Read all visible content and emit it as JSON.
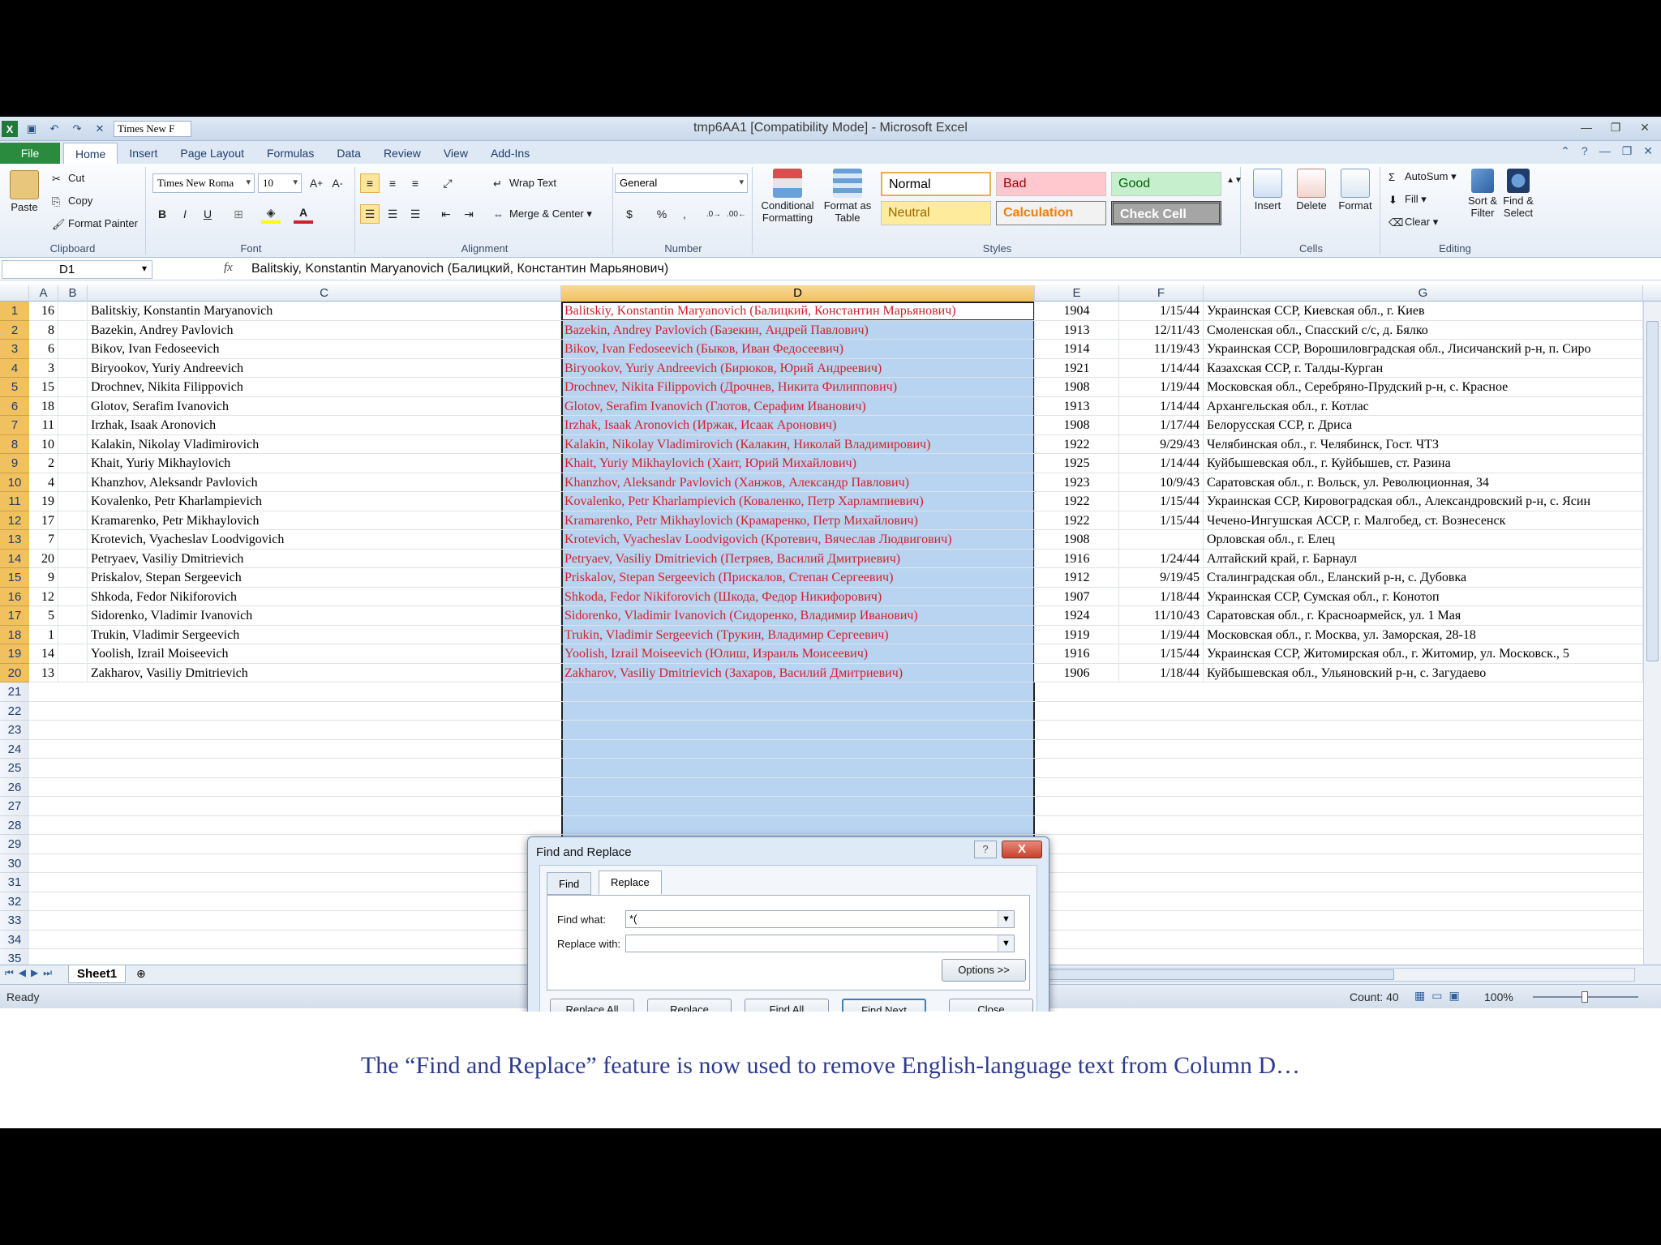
{
  "window": {
    "title": "tmp6AA1  [Compatibility Mode]  -  Microsoft Excel",
    "qat_font": "Times New F"
  },
  "ribbon_tabs": [
    "File",
    "Home",
    "Insert",
    "Page Layout",
    "Formulas",
    "Data",
    "Review",
    "View",
    "Add-Ins"
  ],
  "ribbon": {
    "clipboard": {
      "label": "Clipboard",
      "paste": "Paste",
      "cut": "Cut",
      "copy": "Copy",
      "format_painter": "Format Painter"
    },
    "font": {
      "label": "Font",
      "name": "Times New Roma",
      "size": "10"
    },
    "alignment": {
      "label": "Alignment",
      "wrap": "Wrap Text",
      "merge": "Merge & Center"
    },
    "number": {
      "label": "Number",
      "format": "General"
    },
    "styles": {
      "label": "Styles",
      "conditional": "Conditional Formatting",
      "format_table": "Format as Table",
      "normal": "Normal",
      "bad": "Bad",
      "good": "Good",
      "neutral": "Neutral",
      "calculation": "Calculation",
      "check_cell": "Check Cell"
    },
    "cells": {
      "label": "Cells",
      "insert": "Insert",
      "delete": "Delete",
      "format": "Format"
    },
    "editing": {
      "label": "Editing",
      "autosum": "AutoSum",
      "fill": "Fill",
      "clear": "Clear",
      "sort": "Sort & Filter",
      "find": "Find & Select"
    }
  },
  "formula_bar": {
    "name_box": "D1",
    "fx": "fx",
    "content": "Balitskiy, Konstantin Maryanovich (Балицкий, Константин Марьянович)"
  },
  "columns": [
    "A",
    "B",
    "C",
    "D",
    "E",
    "F",
    "G"
  ],
  "rows": [
    {
      "n": "1",
      "a": "16",
      "c": "Balitskiy, Konstantin Maryanovich",
      "d": "Balitskiy, Konstantin Maryanovich (Балицкий, Константин Марьянович)",
      "e": "1904",
      "f": "1/15/44",
      "g": "Украинская ССР, Киевская обл., г. Киев"
    },
    {
      "n": "2",
      "a": "8",
      "c": "Bazekin, Andrey Pavlovich",
      "d": "Bazekin, Andrey Pavlovich (Базекин, Андрей Павлович)",
      "e": "1913",
      "f": "12/11/43",
      "g": "Смоленская обл., Спасский с/с, д. Бялко"
    },
    {
      "n": "3",
      "a": "6",
      "c": "Bikov, Ivan Fedoseevich",
      "d": "Bikov, Ivan Fedoseevich (Быков, Иван Федосеевич)",
      "e": "1914",
      "f": "11/19/43",
      "g": "Украинская ССР, Ворошиловградская обл., Лисичанский р-н, п. Сиро"
    },
    {
      "n": "4",
      "a": "3",
      "c": "Biryookov, Yuriy Andreevich",
      "d": "Biryookov, Yuriy Andreevich (Бирюков, Юрий Андреевич)",
      "e": "1921",
      "f": "1/14/44",
      "g": "Казахская ССР, г. Талды-Курган"
    },
    {
      "n": "5",
      "a": "15",
      "c": "Drochnev, Nikita Filippovich",
      "d": "Drochnev, Nikita Filippovich (Дрочнев, Никита Филиппович)",
      "e": "1908",
      "f": "1/19/44",
      "g": "Московская обл., Серебряно-Прудский р-н, с. Красное"
    },
    {
      "n": "6",
      "a": "18",
      "c": "Glotov, Serafim Ivanovich",
      "d": "Glotov, Serafim Ivanovich (Глотов, Серафим Иванович)",
      "e": "1913",
      "f": "1/14/44",
      "g": "Архангельская обл., г. Котлас"
    },
    {
      "n": "7",
      "a": "11",
      "c": "Irzhak, Isaak Aronovich",
      "d": "Irzhak, Isaak Aronovich (Иржак, Исаак Аронович)",
      "e": "1908",
      "f": "1/17/44",
      "g": "Белорусская ССР, г. Дриса"
    },
    {
      "n": "8",
      "a": "10",
      "c": "Kalakin, Nikolay Vladimirovich",
      "d": "Kalakin, Nikolay Vladimirovich (Калакин, Николай Владимирович)",
      "e": "1922",
      "f": "9/29/43",
      "g": "Челябинская обл., г. Челябинск, Гост. ЧТЗ"
    },
    {
      "n": "9",
      "a": "2",
      "c": "Khait, Yuriy Mikhaylovich",
      "d": "Khait, Yuriy Mikhaylovich (Хаит, Юрий Михайлович)",
      "e": "1925",
      "f": "1/14/44",
      "g": "Куйбышевская обл., г. Куйбышев, ст. Разина"
    },
    {
      "n": "10",
      "a": "4",
      "c": "Khanzhov, Aleksandr Pavlovich",
      "d": "Khanzhov, Aleksandr Pavlovich (Ханжов, Александр Павлович)",
      "e": "1923",
      "f": "10/9/43",
      "g": "Саратовская обл., г. Вольск, ул. Революционная, 34"
    },
    {
      "n": "11",
      "a": "19",
      "c": "Kovalenko, Petr Kharlampievich",
      "d": "Kovalenko, Petr Kharlampievich (Коваленко, Петр Харлампиевич)",
      "e": "1922",
      "f": "1/15/44",
      "g": "Украинская ССР, Кировоградская обл., Александровский р-н, с. Ясин"
    },
    {
      "n": "12",
      "a": "17",
      "c": "Kramarenko, Petr Mikhaylovich",
      "d": "Kramarenko, Petr Mikhaylovich (Крамаренко, Петр Михайлович)",
      "e": "1922",
      "f": "1/15/44",
      "g": "Чечено-Ингушская АССР, г. Малгобед, ст. Вознесенск"
    },
    {
      "n": "13",
      "a": "7",
      "c": "Krotevich, Vyacheslav Loodvigovich",
      "d": "Krotevich, Vyacheslav Loodvigovich (Кротевич, Вячеслав Людвигович)",
      "e": "1908",
      "f": "",
      "g": "Орловская обл., г. Елец"
    },
    {
      "n": "14",
      "a": "20",
      "c": "Petryaev, Vasiliy Dmitrievich",
      "d": "Petryaev, Vasiliy Dmitrievich (Петряев, Василий Дмитриевич)",
      "e": "1916",
      "f": "1/24/44",
      "g": "Алтайский край, г. Барнаул"
    },
    {
      "n": "15",
      "a": "9",
      "c": "Priskalov, Stepan Sergeevich",
      "d": "Priskalov, Stepan Sergeevich (Прискалов, Степан Сергеевич)",
      "e": "1912",
      "f": "9/19/45",
      "g": "Сталинградская обл., Еланский р-н, с. Дубовка"
    },
    {
      "n": "16",
      "a": "12",
      "c": "Shkoda, Fedor Nikiforovich",
      "d": "Shkoda, Fedor Nikiforovich (Шкода, Федор Никифорович)",
      "e": "1907",
      "f": "1/18/44",
      "g": "Украинская ССР, Сумская обл., г. Конотоп"
    },
    {
      "n": "17",
      "a": "5",
      "c": "Sidorenko, Vladimir Ivanovich",
      "d": "Sidorenko, Vladimir Ivanovich (Сидоренко, Владимир Иванович)",
      "e": "1924",
      "f": "11/10/43",
      "g": "Саратовская обл., г. Красноармейск, ул. 1 Мая"
    },
    {
      "n": "18",
      "a": "1",
      "c": "Trukin, Vladimir Sergeevich",
      "d": "Trukin, Vladimir Sergeevich (Трукин, Владимир Сергеевич)",
      "e": "1919",
      "f": "1/19/44",
      "g": "Московская обл., г. Москва, ул. Заморская, 28-18"
    },
    {
      "n": "19",
      "a": "14",
      "c": "Yoolish, Izrail Moiseevich",
      "d": "Yoolish, Izrail Moiseevich (Юлиш, Израиль Моисеевич)",
      "e": "1916",
      "f": "1/15/44",
      "g": "Украинская ССР, Житомирская обл., г. Житомир, ул. Московск., 5"
    },
    {
      "n": "20",
      "a": "13",
      "c": "Zakharov, Vasiliy Dmitrievich",
      "d": "Zakharov, Vasiliy Dmitrievich (Захаров, Василий Дмитриевич)",
      "e": "1906",
      "f": "1/18/44",
      "g": "Куйбышевская обл., Ульяновский р-н, с. Загудаево"
    }
  ],
  "empty_rows": [
    "21",
    "22",
    "23",
    "24",
    "25",
    "26",
    "27",
    "28",
    "29",
    "30",
    "31",
    "32",
    "33",
    "34",
    "35"
  ],
  "sheet_tab": "Sheet1",
  "status": {
    "ready": "Ready",
    "count": "Count: 40",
    "zoom": "100%"
  },
  "dialog": {
    "title": "Find and Replace",
    "help": "?",
    "close": "X",
    "tabs": [
      "Find",
      "Replace"
    ],
    "find_label": "Find what:",
    "find_value": "*(",
    "replace_label": "Replace with:",
    "replace_value": "",
    "options": "Options >>",
    "replace_all": "Replace All",
    "replace": "Replace",
    "find_all": "Find All",
    "find_next": "Find Next",
    "close_button": "Close"
  },
  "caption": "The “Find and Replace” feature is now used to remove English-language text from Column D…",
  "colors": {
    "accent_selection": "#abcdef",
    "red_text": "#d2202a",
    "file_tab": "#2a8a3e"
  }
}
